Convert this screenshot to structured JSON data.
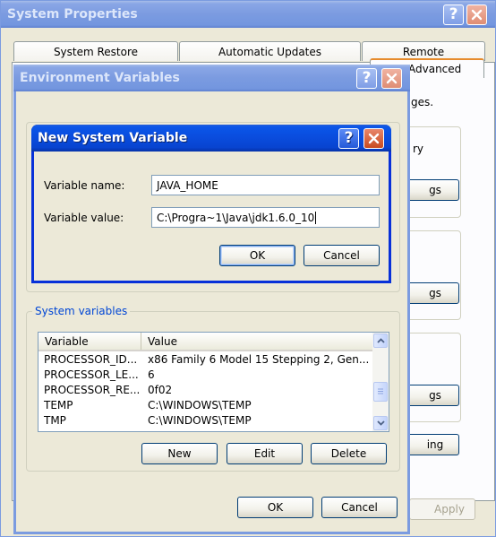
{
  "system_properties": {
    "title": "System Properties",
    "tabs": [
      "System Restore",
      "Automatic Updates",
      "Remote"
    ],
    "peek_tab": "Advanced",
    "peek_text": "ges.",
    "peek_text_2": "ry",
    "peek_buttons": [
      "gs",
      "gs",
      "gs",
      "ing"
    ],
    "apply_label": "Apply"
  },
  "env_vars": {
    "title": "Environment Variables",
    "system_vars_legend": "System variables",
    "columns": [
      "Variable",
      "Value"
    ],
    "rows": [
      {
        "variable": "PROCESSOR_ID...",
        "value": "x86 Family 6 Model 15 Stepping 2, Gen..."
      },
      {
        "variable": "PROCESSOR_LE...",
        "value": "6"
      },
      {
        "variable": "PROCESSOR_RE...",
        "value": "0f02"
      },
      {
        "variable": "TEMP",
        "value": "C:\\WINDOWS\\TEMP"
      },
      {
        "variable": "TMP",
        "value": "C:\\WINDOWS\\TEMP"
      }
    ],
    "buttons": {
      "new": "New",
      "edit": "Edit",
      "delete": "Delete"
    },
    "ok_label": "OK",
    "cancel_label": "Cancel"
  },
  "new_var": {
    "title": "New System Variable",
    "name_label": "Variable name:",
    "name_value": "JAVA_HOME",
    "value_label": "Variable value:",
    "value_value": "C:\\Progra~1\\Java\\jdk1.6.0_10",
    "ok_label": "OK",
    "cancel_label": "Cancel"
  },
  "colors": {
    "active_title": "#0a4ee0",
    "inactive_title": "#7b9be0",
    "dialog_bg": "#ece9d8",
    "group_legend": "#0046d5"
  },
  "icons": [
    "help-icon",
    "close-icon",
    "scroll-up-icon",
    "scroll-down-icon"
  ]
}
